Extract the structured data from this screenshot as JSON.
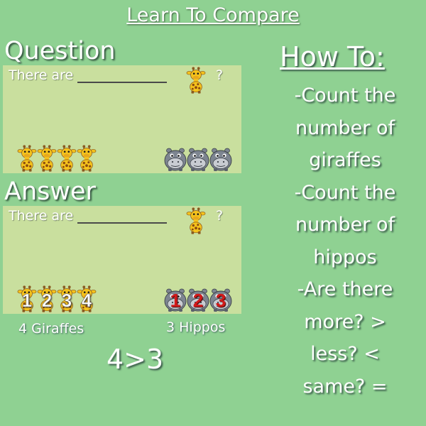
{
  "title": "Learn To Compare",
  "question": {
    "heading": "Question",
    "prompt": "There are",
    "qmark": "?"
  },
  "answer": {
    "heading": "Answer",
    "prompt": "There are",
    "qmark": "?",
    "giraffe_numbers": [
      "1",
      "2",
      "3",
      "4"
    ],
    "hippo_numbers": [
      "1",
      "2",
      "3"
    ],
    "giraffe_caption": "4 Giraffes",
    "hippo_caption": "3 Hippos",
    "result": "4>3"
  },
  "counts": {
    "giraffes": 4,
    "hippos": 3
  },
  "howto": {
    "title": "How To:",
    "lines": [
      "-Count the",
      "number of",
      "giraffes",
      "-Count the",
      "number of",
      "hippos",
      "-Are there",
      "more? >",
      "less? <",
      "same? ="
    ]
  },
  "colors": {
    "background": "#8fd192",
    "panel": "#c9df9e",
    "giraffe": "#f4c21c",
    "giraffe_spots": "#8a4a10",
    "hippo": "#7d8590",
    "hippo_numbers": "#d21a1a"
  },
  "icons": {
    "giraffe": "giraffe-icon",
    "hippo": "hippo-icon"
  }
}
